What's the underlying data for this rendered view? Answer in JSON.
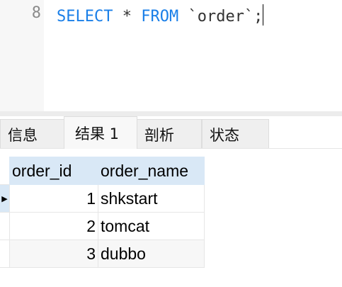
{
  "editor": {
    "line_number": "8",
    "kw_select": "SELECT",
    "star": "*",
    "kw_from": "FROM",
    "table_ref": "`order`;"
  },
  "tabs": [
    {
      "label": "信息"
    },
    {
      "label": "结果 1",
      "active": true
    },
    {
      "label": "剖析"
    },
    {
      "label": "状态"
    }
  ],
  "grid": {
    "columns": [
      "order_id",
      "order_name"
    ],
    "rows": [
      [
        "1",
        "shkstart"
      ],
      [
        "2",
        "tomcat"
      ],
      [
        "3",
        "dubbo"
      ]
    ],
    "current_row_marker": "▶"
  }
}
